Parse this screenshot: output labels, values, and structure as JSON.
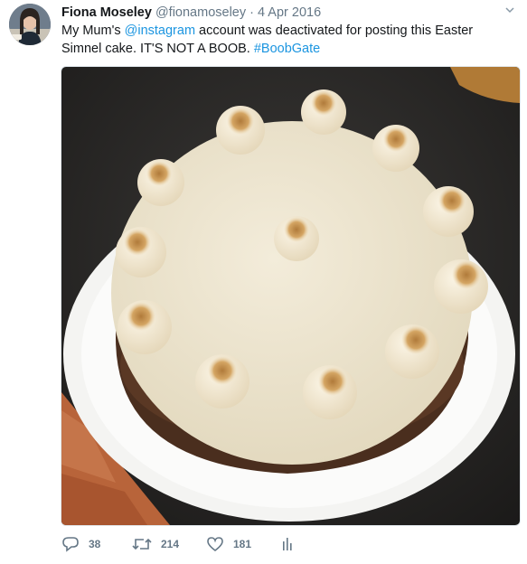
{
  "tweet": {
    "author_name": "Fiona Moseley",
    "handle": "@fionamoseley",
    "separator": "·",
    "date": "4 Apr 2016",
    "text_part1": "My Mum's ",
    "mention": "@instagram",
    "text_part2": " account was deactivated for posting this Easter Simnel cake. IT'S NOT A BOOB. ",
    "hashtag": "#BoobGate",
    "link_color": "#1b95e0"
  },
  "actions": {
    "replies": "38",
    "retweets": "214",
    "likes": "181"
  },
  "icons": {
    "reply": "reply-icon",
    "retweet": "retweet-icon",
    "like": "heart-icon",
    "analytics": "analytics-icon",
    "more": "chevron-down-icon"
  }
}
